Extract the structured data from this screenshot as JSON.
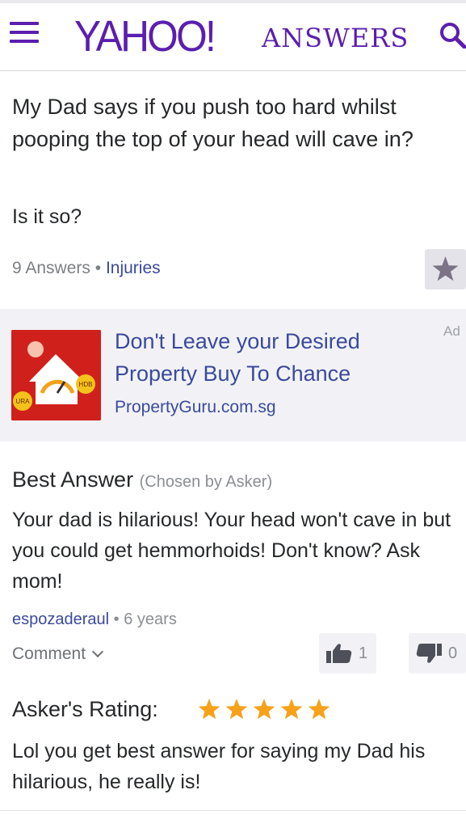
{
  "header": {
    "logo_text": "YAHOO!",
    "section_text": "ANSWERS",
    "menu_icon": "hamburger-menu-icon",
    "search_icon": "search-icon",
    "brand_color": "#5b1eaf"
  },
  "question": {
    "title": "My Dad says if you push too hard whilst pooping the top of your head will cave in?",
    "detail": "Is it so?",
    "answers_count": "9 Answers",
    "separator": "•",
    "category": "Injuries",
    "star_icon": "star-icon"
  },
  "ad": {
    "title": "Don't Leave your Desired Property Buy To Chance",
    "domain": "PropertyGuru.com.sg",
    "label": "Ad",
    "badge_hdb": "HDB",
    "badge_ura": "URA",
    "link_color": "#3a4a9c"
  },
  "best_answer": {
    "heading": "Best Answer",
    "chosen_by": "(Chosen by Asker)",
    "text": "Your dad is hilarious! Your head won't cave in but you could get hemmorhoids! Don't know? Ask mom!",
    "user": "espozaderaul",
    "separator": "•",
    "age": "6 years",
    "comment_label": "Comment",
    "thumbs_up_count": "1",
    "thumbs_down_count": "0"
  },
  "rating": {
    "label": "Asker's Rating:",
    "stars": 5,
    "star_color": "#f7a11a",
    "text": "Lol you get best answer for saying my Dad his hilarious, he really is!"
  }
}
